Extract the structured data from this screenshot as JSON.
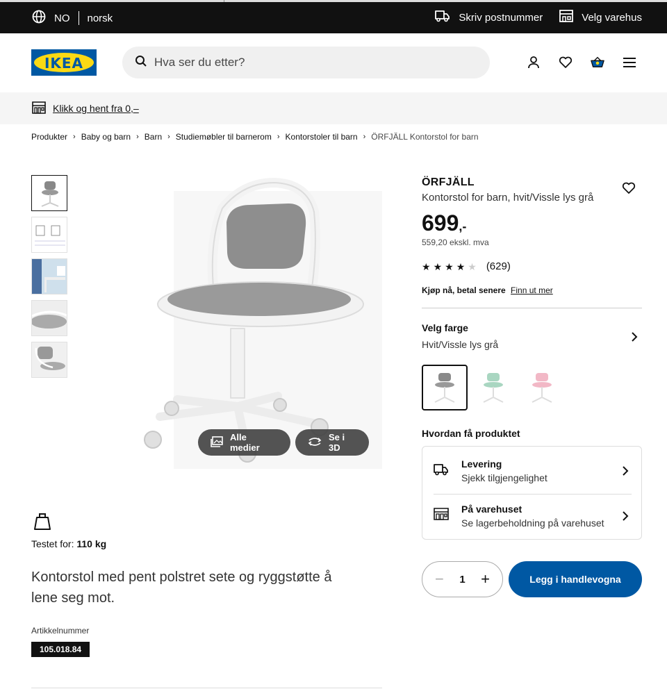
{
  "topbar": {
    "lang_code": "NO",
    "lang_name": "norsk",
    "postcode_label": "Skriv postnummer",
    "store_label": "Velg varehus"
  },
  "header": {
    "logo_text": "IKEA",
    "search_placeholder": "Hva ser du etter?"
  },
  "strip": {
    "click_collect": "Klikk og hent fra 0,–"
  },
  "breadcrumb": [
    "Produkter",
    "Baby og barn",
    "Barn",
    "Studiemøbler til barnerom",
    "Kontorstoler til barn",
    "ÖRFJÄLL Kontorstol for barn"
  ],
  "media": {
    "all_media": "Alle medier",
    "see_3d": "Se i 3D"
  },
  "product": {
    "name": "ÖRFJÄLL",
    "description": "Kontorstol for barn, hvit/Vissle lys grå",
    "price": "699",
    "price_suffix": ",-",
    "price_ex_vat": "559,20 ekskl. mva",
    "rating_count": "(629)",
    "rating_value": 4,
    "klarna_bold": "Kjøp nå, betal senere",
    "klarna_link": "Finn ut mer",
    "tested_label": "Testet for:",
    "tested_value": "110 kg",
    "long_description": "Kontorstol med pent polstret sete og ryggstøtte å lene seg mot.",
    "article_label": "Artikkelnummer",
    "article_number": "105.018.84"
  },
  "color": {
    "title": "Velg farge",
    "value": "Hvit/Vissle lys grå",
    "swatch_colors": [
      "#8a8a8a",
      "#a9d6c1",
      "#f2b8c6"
    ]
  },
  "delivery": {
    "title": "Hvordan få produktet",
    "rows": [
      {
        "title": "Levering",
        "subtitle": "Sjekk tilgjengelighet"
      },
      {
        "title": "På varehuset",
        "subtitle": "Se lagerbeholdning på varehuset"
      }
    ]
  },
  "cart": {
    "quantity": "1",
    "button_label": "Legg i handlevogna"
  },
  "colors": {
    "brand_blue": "#0058a3",
    "brand_yellow": "#fbd914",
    "topbar_bg": "#111111"
  }
}
